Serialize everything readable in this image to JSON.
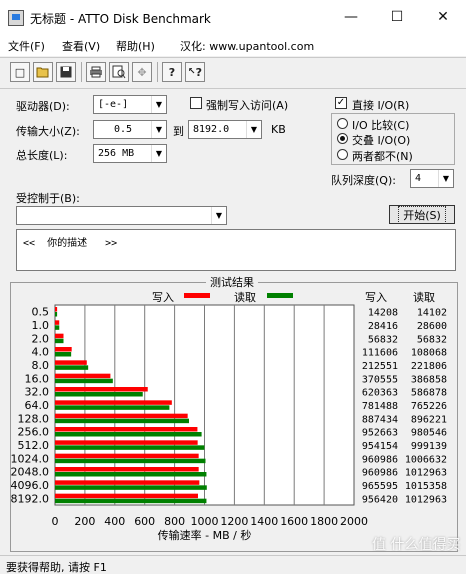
{
  "window": {
    "title": "无标题 - ATTO Disk Benchmark",
    "minimize_glyph": "—",
    "maximize_glyph": "☐",
    "close_glyph": "✕"
  },
  "menu": [
    "文件(F)",
    "查看(V)",
    "帮助(H)",
    "汉化: www.upantool.com"
  ],
  "toolbar": [
    {
      "icon": "new-document-icon",
      "glyph": "□"
    },
    {
      "icon": "open-folder-icon",
      "glyph": "📂"
    },
    {
      "icon": "save-icon",
      "glyph": "💾"
    },
    {
      "icon": "print-icon",
      "glyph": "🖶"
    },
    {
      "icon": "print-preview-icon",
      "glyph": "🔍"
    },
    {
      "icon": "move-icon",
      "glyph": "✥"
    },
    {
      "icon": "help-icon",
      "glyph": "?"
    },
    {
      "icon": "context-help-icon",
      "glyph": "?"
    }
  ],
  "settings": {
    "drive_label": "驱动器(D):",
    "drive_value": "[-e-]",
    "transfer_label": "传输大小(Z):",
    "transfer_from": "0.5",
    "transfer_to_label": "到",
    "transfer_to": "8192.0",
    "transfer_unit": "KB",
    "length_label": "总长度(L):",
    "length_value": "256 MB",
    "force_write_label": "强制写入访问(A)",
    "force_write_checked": false,
    "direct_io_label": "直接 I/O(R)",
    "direct_io_checked": true,
    "io_compare_label": "I/O 比较(C)",
    "io_overlap_label": "交叠 I/O(O)",
    "neither_label": "两者都不(N)",
    "selected_mode": "io_overlap",
    "queue_label": "队列深度(Q):",
    "queue_value": "4",
    "controlled_by_label": "受控制于(B):",
    "controlled_by_value": "",
    "start_button_label": "开始(S)",
    "description_text": "<<  你的描述   >>"
  },
  "results": {
    "title": "测试结果",
    "write_label": "写入",
    "read_label": "读取",
    "write_header": "写入",
    "read_header": "读取",
    "colors": {
      "write": "#ff0000",
      "read": "#008000"
    }
  },
  "chart_data": {
    "type": "bar",
    "orientation": "horizontal",
    "categories": [
      "0.5",
      "1.0",
      "2.0",
      "4.0",
      "8.0",
      "16.0",
      "32.0",
      "64.0",
      "128.0",
      "256.0",
      "512.0",
      "1024.0",
      "2048.0",
      "4096.0",
      "8192.0"
    ],
    "series": [
      {
        "name": "写入",
        "values": [
          14208,
          28416,
          56832,
          111606,
          212551,
          370555,
          620363,
          781488,
          887434,
          952663,
          954154,
          960986,
          960986,
          965595,
          956420
        ]
      },
      {
        "name": "读取",
        "values": [
          14102,
          28600,
          56832,
          108068,
          221806,
          386858,
          586878,
          765226,
          896221,
          980546,
          999139,
          1006632,
          1012963,
          1015358,
          1012963
        ]
      }
    ],
    "xlabel": "传输速率 - MB / 秒",
    "xticks": [
      "0",
      "200",
      "400",
      "600",
      "800",
      "1000",
      "1200",
      "1400",
      "1600",
      "1800",
      "2000"
    ],
    "xlim": [
      0,
      2000
    ],
    "grid": true,
    "legend": "top"
  },
  "status": {
    "text": "要获得帮助, 请按 F1"
  },
  "watermark": "值 什么值得买"
}
